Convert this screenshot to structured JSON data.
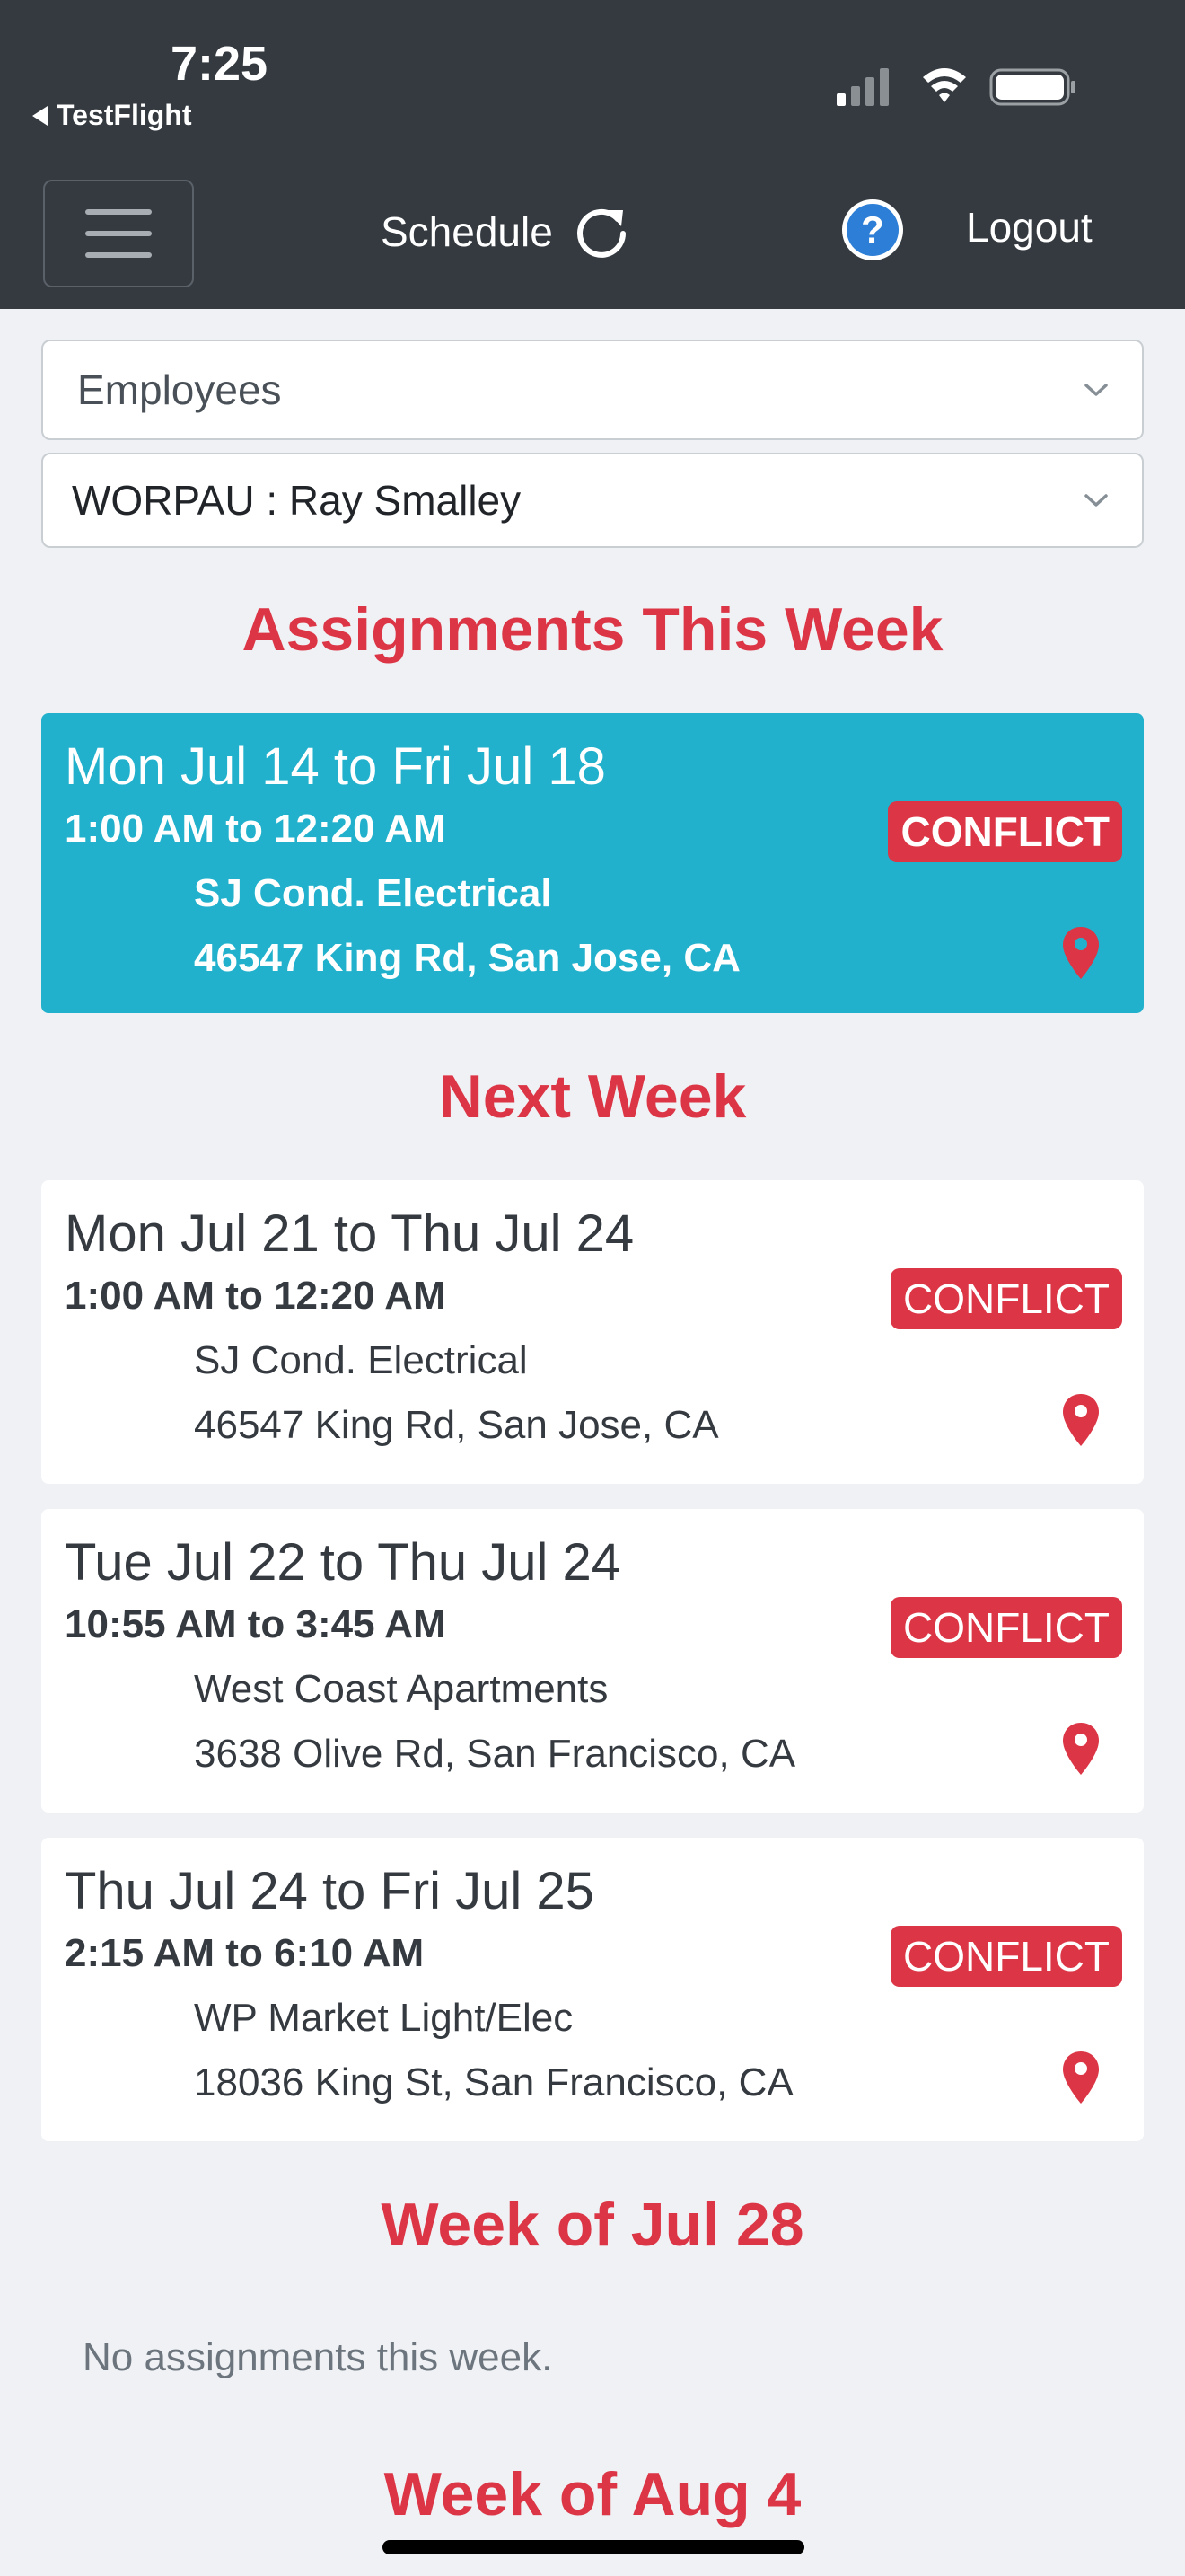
{
  "status_bar": {
    "time": "7:25",
    "back_app": "TestFlight"
  },
  "navbar": {
    "title": "Schedule",
    "logout_label": "Logout"
  },
  "filters": {
    "group_select": "Employees",
    "employee_select": "WORPAU : Ray Smalley"
  },
  "sections": {
    "this_week": "Assignments This Week",
    "next_week": "Next Week",
    "week_jul28": "Week of Jul 28",
    "week_aug4": "Week of Aug 4"
  },
  "assignments": [
    {
      "dates": "Mon Jul 14 to Fri Jul 18",
      "times": "1:00 AM to 12:20 AM",
      "site": "SJ Cond. Electrical",
      "address": "46547 King Rd, San Jose, CA",
      "badge": "CONFLICT"
    },
    {
      "dates": "Mon Jul 21 to Thu Jul 24",
      "times": "1:00 AM to 12:20 AM",
      "site": "SJ Cond. Electrical",
      "address": "46547 King Rd, San Jose, CA",
      "badge": "CONFLICT"
    },
    {
      "dates": "Tue Jul 22 to Thu Jul 24",
      "times": "10:55 AM to 3:45 AM",
      "site": "West Coast Apartments",
      "address": "3638 Olive Rd, San Francisco, CA",
      "badge": "CONFLICT"
    },
    {
      "dates": "Thu Jul 24 to Fri Jul 25",
      "times": "2:15 AM to 6:10 AM",
      "site": "WP Market Light/Elec",
      "address": "18036 King St, San Francisco, CA",
      "badge": "CONFLICT"
    }
  ],
  "empty_week_message": "No assignments this week.",
  "colors": {
    "header_bg": "#343a40",
    "accent_red": "#dc3545",
    "current_card_bg": "#22b1cc",
    "page_bg": "#eff1f4"
  },
  "icons": [
    "refresh-icon",
    "help-icon",
    "map-pin-icon",
    "chevron-down-icon",
    "hamburger-icon"
  ]
}
